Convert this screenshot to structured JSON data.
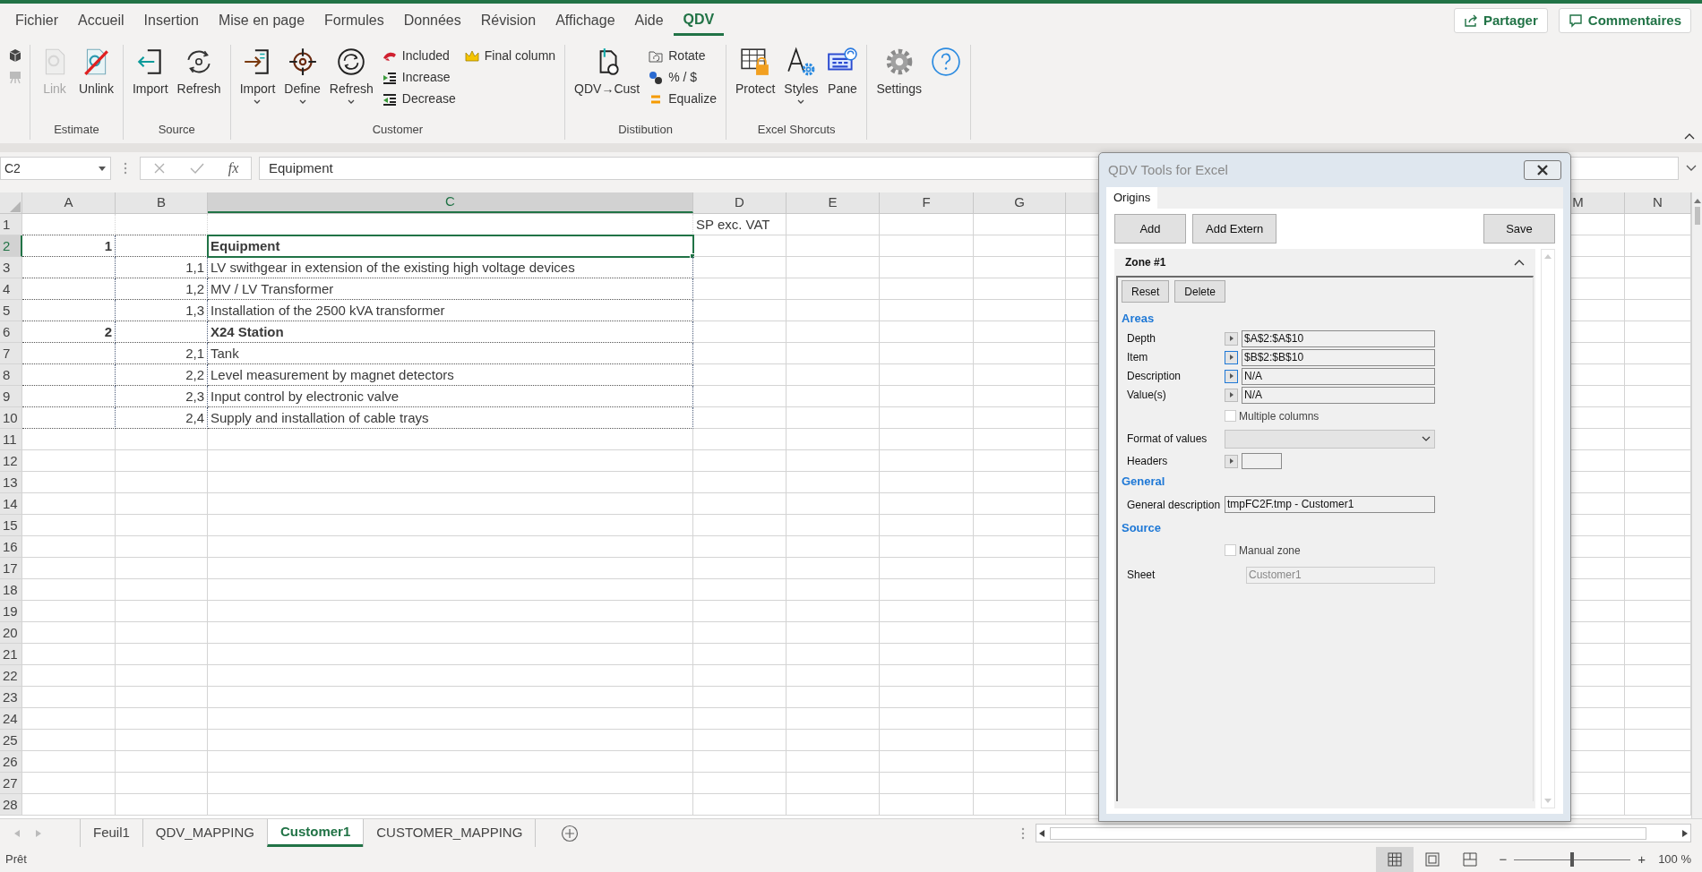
{
  "menu_tabs": [
    {
      "label": "Fichier",
      "selected": false
    },
    {
      "label": "Accueil",
      "selected": false
    },
    {
      "label": "Insertion",
      "selected": false
    },
    {
      "label": "Mise en page",
      "selected": false
    },
    {
      "label": "Formules",
      "selected": false
    },
    {
      "label": "Données",
      "selected": false
    },
    {
      "label": "Révision",
      "selected": false
    },
    {
      "label": "Affichage",
      "selected": false
    },
    {
      "label": "Aide",
      "selected": false
    },
    {
      "label": "QDV",
      "selected": true
    }
  ],
  "share_buttons": [
    "Partager",
    "Commentaires"
  ],
  "ribbon": {
    "groups": [
      {
        "label": "Estimate",
        "buttons": [
          {
            "kind": "large",
            "label": "Link",
            "disabled": true,
            "dropdown": false
          },
          {
            "kind": "large",
            "label": "Unlink",
            "disabled": false,
            "dropdown": false
          }
        ]
      },
      {
        "label": "Source",
        "buttons": [
          {
            "kind": "large",
            "label": "Import",
            "disabled": false,
            "dropdown": false
          },
          {
            "kind": "large",
            "label": "Refresh",
            "disabled": false,
            "dropdown": false
          }
        ]
      },
      {
        "label": "Customer",
        "buttons": [
          {
            "kind": "large",
            "label": "Import",
            "disabled": false,
            "dropdown": true
          },
          {
            "kind": "large",
            "label": "Define",
            "disabled": false,
            "dropdown": true
          },
          {
            "kind": "large",
            "label": "Refresh",
            "disabled": false,
            "dropdown": true
          },
          {
            "kind": "small",
            "label": "Included"
          },
          {
            "kind": "small",
            "label": "Increase"
          },
          {
            "kind": "small",
            "label": "Decrease"
          },
          {
            "kind": "small",
            "label": "Final column"
          }
        ]
      },
      {
        "label": "Distibution",
        "buttons": [
          {
            "kind": "large",
            "label": "QDV→Cust",
            "disabled": false,
            "dropdown": false
          },
          {
            "kind": "small",
            "label": "Rotate"
          },
          {
            "kind": "small",
            "label": "% / $"
          },
          {
            "kind": "small",
            "label": "Equalize"
          }
        ]
      },
      {
        "label": "Excel Shorcuts",
        "buttons": [
          {
            "kind": "large",
            "label": "Protect",
            "disabled": false,
            "dropdown": false
          },
          {
            "kind": "large",
            "label": "Styles",
            "disabled": false,
            "dropdown": true
          },
          {
            "kind": "large",
            "label": "Pane",
            "disabled": false,
            "dropdown": false
          }
        ]
      },
      {
        "buttons": [
          {
            "kind": "large",
            "label": "Settings",
            "disabled": false,
            "dropdown": false
          },
          {
            "kind": "large",
            "disabled": false,
            "dropdown": false
          }
        ]
      }
    ]
  },
  "formula_bar": {
    "name_box": "C2",
    "function_label": "fx",
    "content": "Equipment"
  },
  "sheet": {
    "columns": [
      {
        "letter": "A",
        "selected": false
      },
      {
        "letter": "B",
        "selected": false
      },
      {
        "letter": "C",
        "selected": true
      },
      {
        "letter": "D",
        "selected": false
      },
      {
        "letter": "E",
        "selected": false
      },
      {
        "letter": "F",
        "selected": false
      },
      {
        "letter": "G",
        "selected": false
      },
      {
        "letter": "M",
        "selected": false
      },
      {
        "letter": "N",
        "selected": false
      }
    ],
    "rows": [
      {
        "number": "1",
        "kind": "title",
        "selected": false,
        "d": "SP exc. VAT"
      },
      {
        "number": "2",
        "kind": "heading",
        "selected": true,
        "a": "1",
        "c": "Equipment"
      },
      {
        "number": "3",
        "kind": "item",
        "selected": false,
        "b": "1,1",
        "c": "LV swithgear in extension of the existing high voltage devices"
      },
      {
        "number": "4",
        "kind": "item",
        "selected": false,
        "b": "1,2",
        "c": "MV / LV Transformer"
      },
      {
        "number": "5",
        "kind": "item",
        "selected": false,
        "b": "1,3",
        "c": "Installation of the 2500 kVA transformer"
      },
      {
        "number": "6",
        "kind": "heading",
        "selected": false,
        "a": "2",
        "c": "X24 Station"
      },
      {
        "number": "7",
        "kind": "item",
        "selected": false,
        "b": "2,1",
        "c": "Tank"
      },
      {
        "number": "8",
        "kind": "item",
        "selected": false,
        "b": "2,2",
        "c": "Level measurement by magnet detectors"
      },
      {
        "number": "9",
        "kind": "item",
        "selected": false,
        "b": "2,3",
        "c": "Input control by electronic valve"
      },
      {
        "number": "10",
        "kind": "item",
        "selected": false,
        "b": "2,4",
        "c": "Supply and installation of cable trays"
      },
      {
        "number": "11",
        "kind": "empty",
        "selected": false
      },
      {
        "number": "12",
        "kind": "empty",
        "selected": false
      },
      {
        "number": "13",
        "kind": "empty",
        "selected": false
      },
      {
        "number": "14",
        "kind": "empty",
        "selected": false
      },
      {
        "number": "15",
        "kind": "empty",
        "selected": false
      },
      {
        "number": "16",
        "kind": "empty",
        "selected": false
      },
      {
        "number": "17",
        "kind": "empty",
        "selected": false
      },
      {
        "number": "18",
        "kind": "empty",
        "selected": false
      },
      {
        "number": "19",
        "kind": "empty",
        "selected": false
      },
      {
        "number": "20",
        "kind": "empty",
        "selected": false
      },
      {
        "number": "21",
        "kind": "empty",
        "selected": false
      },
      {
        "number": "22",
        "kind": "empty",
        "selected": false
      },
      {
        "number": "23",
        "kind": "empty",
        "selected": false
      },
      {
        "number": "24",
        "kind": "empty",
        "selected": false
      },
      {
        "number": "25",
        "kind": "empty",
        "selected": false
      },
      {
        "number": "26",
        "kind": "empty",
        "selected": false
      },
      {
        "number": "27",
        "kind": "empty",
        "selected": false
      },
      {
        "number": "28",
        "kind": "empty",
        "selected": false
      }
    ]
  },
  "dialog": {
    "title": "QDV Tools for Excel",
    "tabs": [
      {
        "label": "Origins",
        "selected": true
      }
    ],
    "buttons": [
      "Add",
      "Add Extern"
    ],
    "save_button": "Save",
    "zone": {
      "title": "Zone #1",
      "expanded": true,
      "buttons": [
        "Reset",
        "Delete"
      ],
      "sections": [
        {
          "title": "Areas",
          "fields": [
            {
              "kind": "range",
              "label": "Depth",
              "value": "$A$2:$A$10",
              "highlighted": false
            },
            {
              "kind": "range",
              "label": "Item",
              "value": "$B$2:$B$10",
              "highlighted": true
            },
            {
              "kind": "range",
              "label": "Description",
              "value": "N/A",
              "highlighted": true
            },
            {
              "kind": "range",
              "label": "Value(s)",
              "value": "N/A",
              "highlighted": false
            },
            {
              "kind": "checkbox",
              "label": "Multiple columns",
              "checked": false
            },
            {
              "kind": "select",
              "label": "Format of values"
            },
            {
              "kind": "range_short",
              "label": "Headers",
              "highlighted": false
            }
          ]
        },
        {
          "title": "General",
          "fields": [
            {
              "kind": "text",
              "label": "General description",
              "value": "tmpFC2F.tmp - Customer1",
              "disabled": false
            }
          ]
        },
        {
          "title": "Source",
          "fields": [
            {
              "kind": "checkbox",
              "label": "Manual zone",
              "checked": false
            },
            {
              "kind": "text",
              "label": "Sheet",
              "value": "Customer1",
              "disabled": true
            }
          ]
        }
      ]
    }
  },
  "sheet_tabs": [
    {
      "label": "Feuil1",
      "selected": false
    },
    {
      "label": "QDV_MAPPING",
      "selected": false
    },
    {
      "label": "Customer1",
      "selected": true
    },
    {
      "label": "CUSTOMER_MAPPING",
      "selected": false
    }
  ],
  "status_bar": {
    "text": "Prêt",
    "views": [
      {
        "selected": true
      },
      {
        "selected": false
      },
      {
        "selected": false
      }
    ],
    "zoom_out": "−",
    "zoom_in": "+",
    "zoom": {
      "level": 0.5
    },
    "zoom_text": "100 %"
  }
}
